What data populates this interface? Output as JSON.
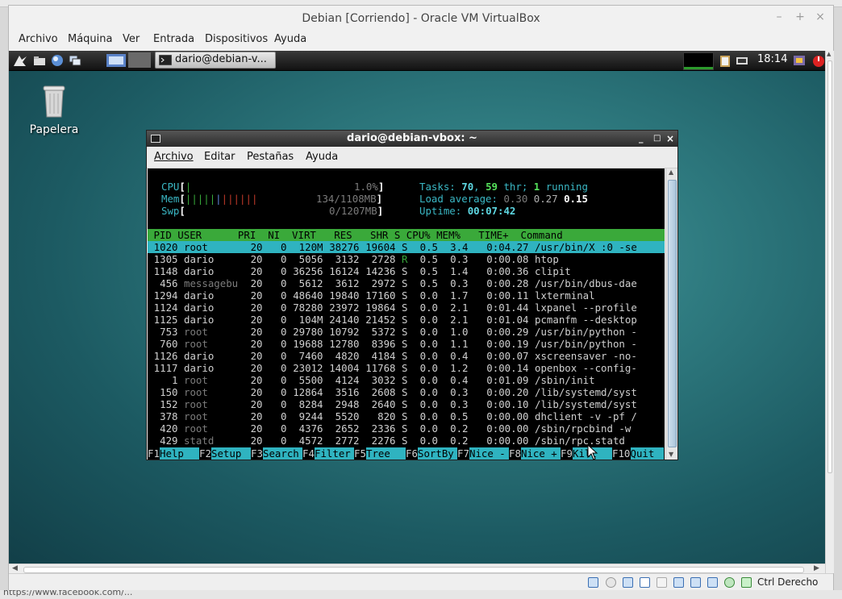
{
  "host": {
    "status_text": "https://www.facebook.com/..."
  },
  "window": {
    "title": "Debian [Corriendo] - Oracle VM VirtualBox",
    "controls": [
      "–",
      "+",
      "×"
    ]
  },
  "menu": [
    "Archivo",
    "Máquina",
    "Ver",
    "Entrada",
    "Dispositivos",
    "Ayuda"
  ],
  "panel": {
    "task_title": "dario@debian-v...",
    "clock": "18:14"
  },
  "desktop": {
    "trash_label": "Papelera"
  },
  "terminal": {
    "title": "dario@debian-vbox: ~",
    "menu": [
      "Archivo",
      "Editar",
      "Pestañas",
      "Ayuda"
    ]
  },
  "htop": {
    "meters": {
      "cpu_label": "CPU",
      "cpu_value": "1.0%",
      "mem_label": "Mem",
      "mem_value": "134/1108MB",
      "swp_label": "Swp",
      "swp_value": "0/1207MB"
    },
    "tasks": {
      "label": "Tasks:",
      "procs": "70",
      "threads": "59",
      "thr": "thr;",
      "running": "1",
      "running_label": "running"
    },
    "load": {
      "label": "Load average:",
      "l1": "0.30",
      "l5": "0.27",
      "l15": "0.15"
    },
    "uptime": {
      "label": "Uptime:",
      "value": "00:07:42"
    },
    "header": " PID USER      PRI  NI  VIRT   RES   SHR S CPU% MEM%   TIME+  Command",
    "rows": [
      {
        "pid": "1020",
        "user": "root",
        "pri": "20",
        "ni": "0",
        "virt": "120M",
        "res": "38276",
        "shr": "19604",
        "s": "S",
        "cpu": "0.5",
        "mem": "3.4",
        "time": "0:04.27",
        "cmd": "/usr/bin/X :0 -se"
      },
      {
        "pid": "1305",
        "user": "dario",
        "pri": "20",
        "ni": "0",
        "virt": "5056",
        "res": "3132",
        "shr": "2728",
        "s": "R",
        "cpu": "0.5",
        "mem": "0.3",
        "time": "0:00.08",
        "cmd": "htop"
      },
      {
        "pid": "1148",
        "user": "dario",
        "pri": "20",
        "ni": "0",
        "virt": "36256",
        "res": "16124",
        "shr": "14236",
        "s": "S",
        "cpu": "0.5",
        "mem": "1.4",
        "time": "0:00.36",
        "cmd": "clipit"
      },
      {
        "pid": "456",
        "user": "messagebu",
        "pri": "20",
        "ni": "0",
        "virt": "5612",
        "res": "3612",
        "shr": "2972",
        "s": "S",
        "cpu": "0.5",
        "mem": "0.3",
        "time": "0:00.28",
        "cmd": "/usr/bin/dbus-dae"
      },
      {
        "pid": "1294",
        "user": "dario",
        "pri": "20",
        "ni": "0",
        "virt": "48640",
        "res": "19840",
        "shr": "17160",
        "s": "S",
        "cpu": "0.0",
        "mem": "1.7",
        "time": "0:00.11",
        "cmd": "lxterminal"
      },
      {
        "pid": "1124",
        "user": "dario",
        "pri": "20",
        "ni": "0",
        "virt": "78280",
        "res": "23972",
        "shr": "19864",
        "s": "S",
        "cpu": "0.0",
        "mem": "2.1",
        "time": "0:01.44",
        "cmd": "lxpanel --profile"
      },
      {
        "pid": "1125",
        "user": "dario",
        "pri": "20",
        "ni": "0",
        "virt": "104M",
        "res": "24140",
        "shr": "21452",
        "s": "S",
        "cpu": "0.0",
        "mem": "2.1",
        "time": "0:01.04",
        "cmd": "pcmanfm --desktop"
      },
      {
        "pid": "753",
        "user": "root",
        "pri": "20",
        "ni": "0",
        "virt": "29780",
        "res": "10792",
        "shr": "5372",
        "s": "S",
        "cpu": "0.0",
        "mem": "1.0",
        "time": "0:00.29",
        "cmd": "/usr/bin/python -"
      },
      {
        "pid": "760",
        "user": "root",
        "pri": "20",
        "ni": "0",
        "virt": "19688",
        "res": "12780",
        "shr": "8396",
        "s": "S",
        "cpu": "0.0",
        "mem": "1.1",
        "time": "0:00.19",
        "cmd": "/usr/bin/python -"
      },
      {
        "pid": "1126",
        "user": "dario",
        "pri": "20",
        "ni": "0",
        "virt": "7460",
        "res": "4820",
        "shr": "4184",
        "s": "S",
        "cpu": "0.0",
        "mem": "0.4",
        "time": "0:00.07",
        "cmd": "xscreensaver -no-"
      },
      {
        "pid": "1117",
        "user": "dario",
        "pri": "20",
        "ni": "0",
        "virt": "23012",
        "res": "14004",
        "shr": "11768",
        "s": "S",
        "cpu": "0.0",
        "mem": "1.2",
        "time": "0:00.14",
        "cmd": "openbox --config-"
      },
      {
        "pid": "1",
        "user": "root",
        "pri": "20",
        "ni": "0",
        "virt": "5500",
        "res": "4124",
        "shr": "3032",
        "s": "S",
        "cpu": "0.0",
        "mem": "0.4",
        "time": "0:01.09",
        "cmd": "/sbin/init"
      },
      {
        "pid": "150",
        "user": "root",
        "pri": "20",
        "ni": "0",
        "virt": "12864",
        "res": "3516",
        "shr": "2608",
        "s": "S",
        "cpu": "0.0",
        "mem": "0.3",
        "time": "0:00.20",
        "cmd": "/lib/systemd/syst"
      },
      {
        "pid": "152",
        "user": "root",
        "pri": "20",
        "ni": "0",
        "virt": "8284",
        "res": "2948",
        "shr": "2640",
        "s": "S",
        "cpu": "0.0",
        "mem": "0.3",
        "time": "0:00.10",
        "cmd": "/lib/systemd/syst"
      },
      {
        "pid": "378",
        "user": "root",
        "pri": "20",
        "ni": "0",
        "virt": "9244",
        "res": "5520",
        "shr": "820",
        "s": "S",
        "cpu": "0.0",
        "mem": "0.5",
        "time": "0:00.00",
        "cmd": "dhclient -v -pf /"
      },
      {
        "pid": "420",
        "user": "root",
        "pri": "20",
        "ni": "0",
        "virt": "4376",
        "res": "2652",
        "shr": "2336",
        "s": "S",
        "cpu": "0.0",
        "mem": "0.2",
        "time": "0:00.00",
        "cmd": "/sbin/rpcbind -w"
      },
      {
        "pid": "429",
        "user": "statd",
        "pri": "20",
        "ni": "0",
        "virt": "4572",
        "res": "2772",
        "shr": "2276",
        "s": "S",
        "cpu": "0.0",
        "mem": "0.2",
        "time": "0:00.00",
        "cmd": "/sbin/rpc.statd"
      }
    ],
    "fkeys": [
      {
        "key": "F1",
        "label": "Help  "
      },
      {
        "key": "F2",
        "label": "Setup "
      },
      {
        "key": "F3",
        "label": "Search"
      },
      {
        "key": "F4",
        "label": "Filter"
      },
      {
        "key": "F5",
        "label": "Tree  "
      },
      {
        "key": "F6",
        "label": "SortBy"
      },
      {
        "key": "F7",
        "label": "Nice -"
      },
      {
        "key": "F8",
        "label": "Nice +"
      },
      {
        "key": "F9",
        "label": "Kill  "
      },
      {
        "key": "F10",
        "label": "Quit  "
      }
    ]
  },
  "statusbar": {
    "host_key": "Ctrl Derecho"
  }
}
